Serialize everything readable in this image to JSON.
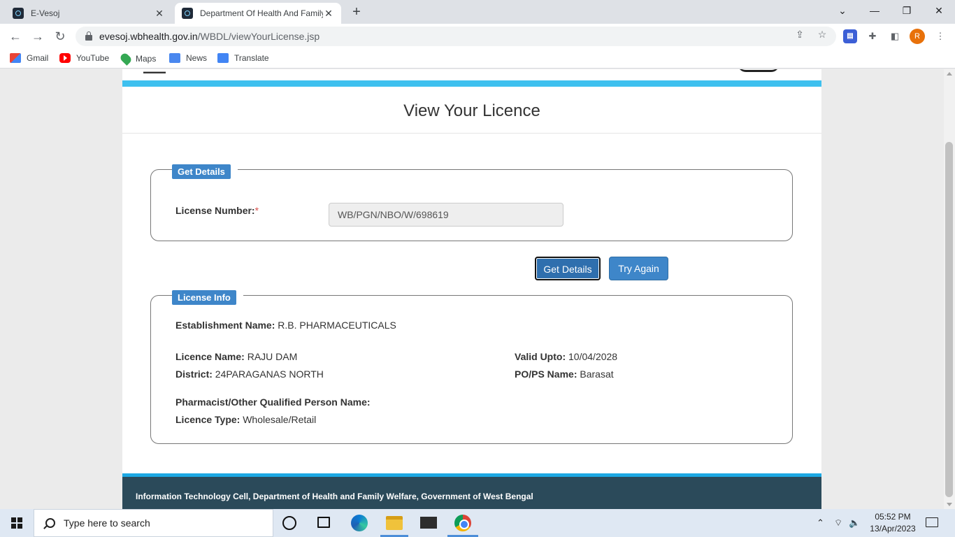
{
  "browser": {
    "tabs": [
      {
        "title": "E-Vesoj",
        "active": false
      },
      {
        "title": "Department Of Health And Family Welfare",
        "active": true
      }
    ],
    "new_tab": "+",
    "window_controls": {
      "minimize": "—",
      "restore": "❐",
      "close": "✕",
      "dropdown": "⌄"
    },
    "url": {
      "host": "evesoj.wbhealth.gov.in",
      "path": "/WBDL/viewYourLicense.jsp"
    },
    "profile_initial": "R",
    "bookmarks": [
      "Gmail",
      "YouTube",
      "Maps",
      "News",
      "Translate"
    ]
  },
  "page": {
    "title": "View Your Licence",
    "get_details_section": {
      "legend": "Get Details",
      "license_label": "License Number:",
      "required_mark": "*",
      "license_value": "WB/PGN/NBO/W/698619"
    },
    "buttons": {
      "get_details": "Get Details",
      "try_again": "Try Again"
    },
    "license_info": {
      "legend": "License Info",
      "establishment_label": "Establishment Name:",
      "establishment_value": "R.B. PHARMACEUTICALS",
      "licence_name_label": "Licence Name:",
      "licence_name_value": "RAJU DAM",
      "valid_upto_label": "Valid Upto:",
      "valid_upto_value": "10/04/2028",
      "district_label": "District:",
      "district_value": "24PARAGANAS NORTH",
      "pops_label": "PO/PS Name:",
      "pops_value": "Barasat",
      "pharmacist_label": "Pharmacist/Other Qualified Person Name:",
      "pharmacist_value": "",
      "licence_type_label": "Licence Type:",
      "licence_type_value": "Wholesale/Retail"
    },
    "footer": "Information Technology Cell, Department of Health and Family Welfare, Government of West Bengal"
  },
  "taskbar": {
    "search_placeholder": "Type here to search",
    "time": "05:52 PM",
    "date": "13/Apr/2023"
  },
  "colors": {
    "accent_blue": "#3e86c9",
    "header_bar": "#3ec0ef",
    "footer_bg": "#2b4a5a"
  }
}
